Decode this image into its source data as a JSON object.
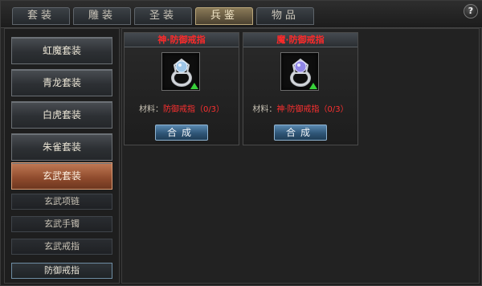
{
  "tabs": [
    {
      "label": "套装"
    },
    {
      "label": "雕装"
    },
    {
      "label": "圣装"
    },
    {
      "label": "兵鉴",
      "active": true
    },
    {
      "label": "物品"
    }
  ],
  "help": {
    "label": "?"
  },
  "left_list": {
    "sets": [
      {
        "label": "虹魔套装"
      },
      {
        "label": "青龙套装"
      },
      {
        "label": "白虎套装"
      },
      {
        "label": "朱雀套装"
      },
      {
        "label": "玄武套装",
        "active": true
      }
    ],
    "sub_items": [
      {
        "label": "玄武项链"
      },
      {
        "label": "玄武手镯"
      },
      {
        "label": "玄武戒指"
      },
      {
        "label": "防御戒指",
        "active": true
      }
    ]
  },
  "cards": [
    {
      "title": "神·防御戒指",
      "material_label": "材料：",
      "material_value": "防御戒指（0/3）",
      "button": "合成",
      "icon": "ring-icon",
      "gem_color": "#9ec6e8"
    },
    {
      "title": "魔·防御戒指",
      "material_label": "材料：",
      "material_value": "神·防御戒指（0/3）",
      "button": "合成",
      "icon": "ring-icon",
      "gem_color": "#8f86e6"
    }
  ]
}
